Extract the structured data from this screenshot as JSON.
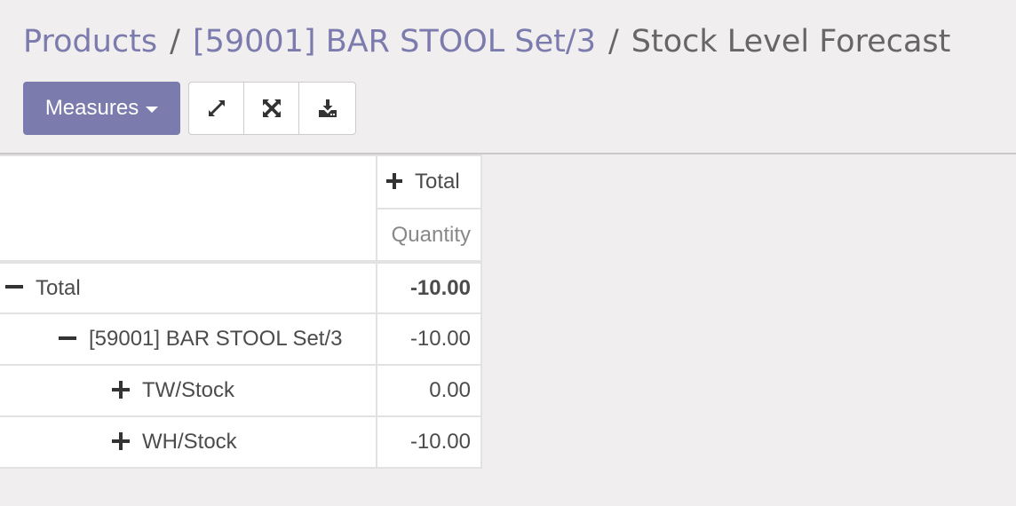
{
  "breadcrumb": {
    "items": [
      "Products",
      "[59001] BAR STOOL Set/3"
    ],
    "separator": "/",
    "current": "Stock Level Forecast"
  },
  "toolbar": {
    "measures_label": "Measures",
    "icons": [
      "expand-arrows-icon",
      "expand-all-icon",
      "download-icon"
    ]
  },
  "pivot": {
    "col_header": "Total",
    "measure": "Quantity",
    "rows": [
      {
        "label": "Total",
        "value": "-10.00",
        "level": 0,
        "toggle": "minus",
        "bold": true
      },
      {
        "label": "[59001] BAR STOOL Set/3",
        "value": "-10.00",
        "level": 1,
        "toggle": "minus",
        "bold": false
      },
      {
        "label": "TW/Stock",
        "value": "0.00",
        "level": 2,
        "toggle": "plus",
        "bold": false
      },
      {
        "label": "WH/Stock",
        "value": "-10.00",
        "level": 2,
        "toggle": "plus",
        "bold": false
      }
    ]
  },
  "colors": {
    "accent": "#7c7bad",
    "background": "#f0eeee",
    "border": "#e2e2e2"
  }
}
